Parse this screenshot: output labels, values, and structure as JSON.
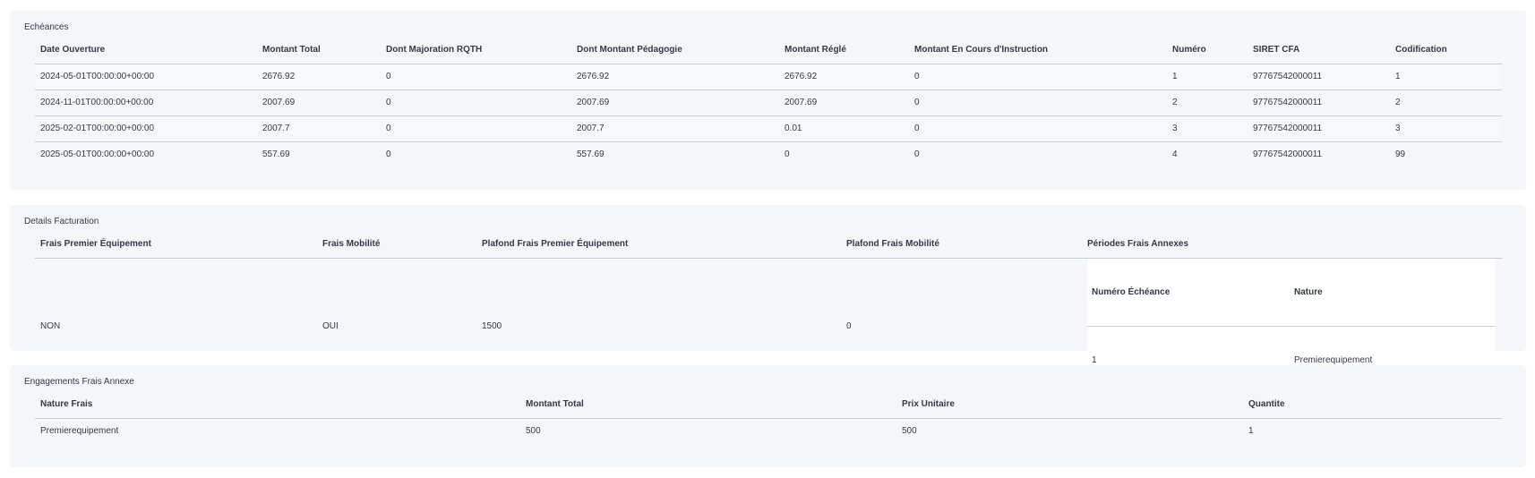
{
  "echeances": {
    "title": "Echéances",
    "columns": [
      "Date Ouverture",
      "Montant Total",
      "Dont Majoration RQTH",
      "Dont Montant Pédagogie",
      "Montant Réglé",
      "Montant En Cours d'Instruction",
      "Numéro",
      "SIRET CFA",
      "Codification"
    ],
    "rows": [
      [
        "2024-05-01T00:00:00+00:00",
        "2676.92",
        "0",
        "2676.92",
        "2676.92",
        "0",
        "1",
        "97767542000011",
        "1"
      ],
      [
        "2024-11-01T00:00:00+00:00",
        "2007.69",
        "0",
        "2007.69",
        "2007.69",
        "0",
        "2",
        "97767542000011",
        "2"
      ],
      [
        "2025-02-01T00:00:00+00:00",
        "2007.7",
        "0",
        "2007.7",
        "0.01",
        "0",
        "3",
        "97767542000011",
        "3"
      ],
      [
        "2025-05-01T00:00:00+00:00",
        "557.69",
        "0",
        "557.69",
        "0",
        "0",
        "4",
        "97767542000011",
        "99"
      ]
    ]
  },
  "details_facturation": {
    "title": "Details Facturation",
    "columns": [
      "Frais Premier Équipement",
      "Frais Mobilité",
      "Plafond Frais Premier Équipement",
      "Plafond Frais Mobilité",
      "Périodes Frais Annexes"
    ],
    "row": [
      "NON",
      "OUI",
      "1500",
      "0"
    ],
    "periodes": {
      "columns": [
        "Numéro Échéance",
        "Nature"
      ],
      "rows": [
        [
          "1",
          "Premierequipement"
        ]
      ]
    }
  },
  "engagements": {
    "title": "Engagements Frais Annexe",
    "columns": [
      "Nature Frais",
      "Montant Total",
      "Prix Unitaire",
      "Quantite"
    ],
    "rows": [
      [
        "Premierequipement",
        "500",
        "500",
        "1"
      ]
    ]
  }
}
